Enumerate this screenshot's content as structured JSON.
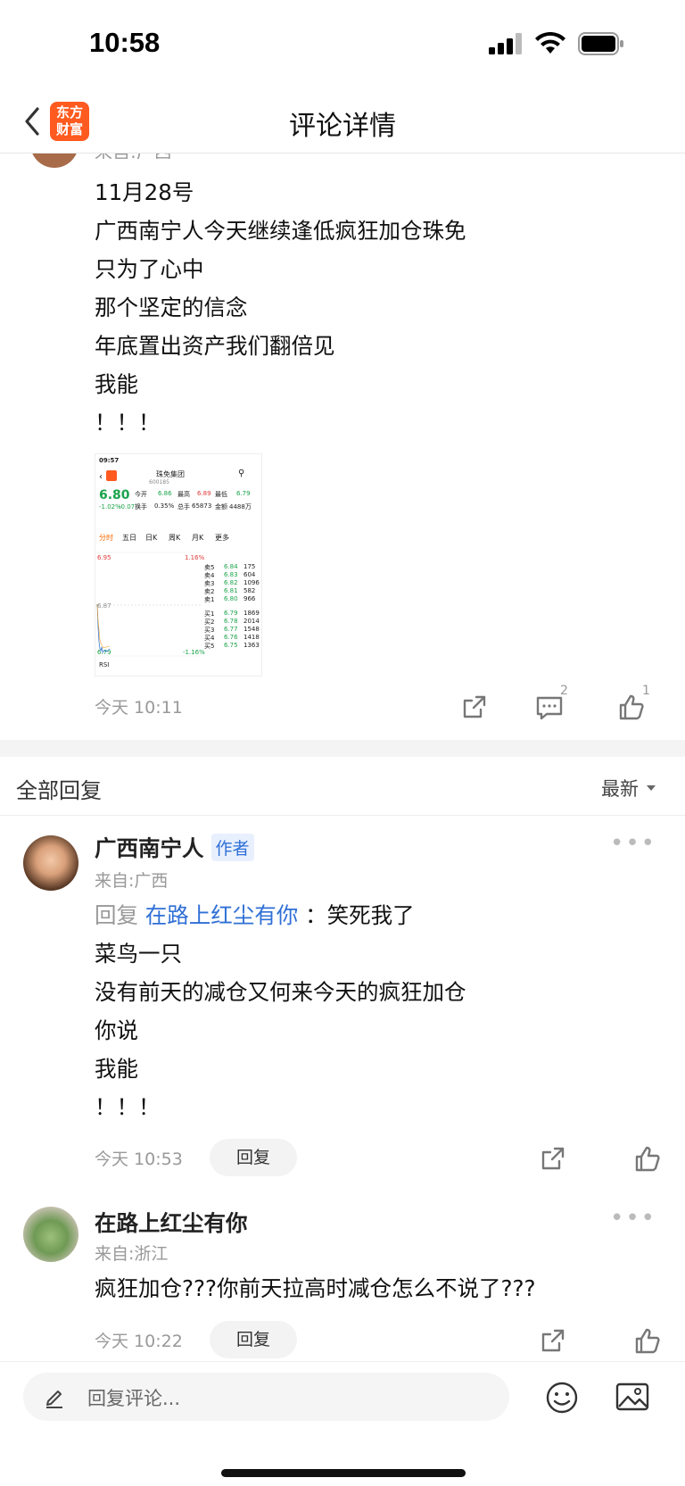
{
  "status": {
    "time": "10:58"
  },
  "nav": {
    "title": "评论详情",
    "logo_line1": "东方",
    "logo_line2": "财富"
  },
  "post": {
    "source_partial": "来自:广西",
    "lines": [
      "11月28号",
      "广西南宁人今天继续逢低疯狂加仓珠免",
      "只为了心中",
      "那个坚定的信念",
      "年底置出资产我们翻倍见",
      "我能",
      "！！！"
    ],
    "thumb": {
      "time": "09:57",
      "stock_name": "珠免集团",
      "stock_code": "600185",
      "price": "6.80",
      "change": "-1.02%",
      "change_abs": "-0.07",
      "open_label": "今开",
      "open": "6.86",
      "high_label": "最高",
      "high": "6.89",
      "low_label": "最低",
      "low": "6.79",
      "turnover_label": "换手",
      "turnover": "0.35%",
      "volume_label": "总手",
      "volume": "65873",
      "amount_label": "金额",
      "amount": "4488万",
      "tabs": [
        "分时",
        "五日",
        "日K",
        "周K",
        "月K",
        "更多"
      ],
      "top_price": "6.95",
      "top_pct": "1.16%",
      "mid_price": "6.87",
      "bottom_price": "6.79",
      "bottom_pct": "-1.16%",
      "asks": [
        [
          "卖5",
          "6.84",
          "175"
        ],
        [
          "卖4",
          "6.83",
          "604"
        ],
        [
          "卖3",
          "6.82",
          "1096"
        ],
        [
          "卖2",
          "6.81",
          "582"
        ],
        [
          "卖1",
          "6.80",
          "966"
        ]
      ],
      "bids": [
        [
          "买1",
          "6.79",
          "1869"
        ],
        [
          "买2",
          "6.78",
          "2014"
        ],
        [
          "买3",
          "6.77",
          "1548"
        ],
        [
          "买4",
          "6.76",
          "1418"
        ],
        [
          "买5",
          "6.75",
          "1363"
        ]
      ],
      "rsi": "RSI"
    },
    "time": "今天 10:11",
    "comment_count": "2",
    "like_count": "1"
  },
  "replies": {
    "title": "全部回复",
    "sort_label": "最新",
    "items": [
      {
        "name": "广西南宁人",
        "badge": "作者",
        "from": "来自:广西",
        "reply_prefix": "回复",
        "reply_target": "在路上红尘有你",
        "reply_first": "：笑死我了",
        "lines": [
          "菜鸟一只",
          "没有前天的减仓又何来今天的疯狂加仓",
          "你说",
          "我能",
          "！！！"
        ],
        "time": "今天 10:53",
        "reply_button": "回复"
      },
      {
        "name": "在路上红尘有你",
        "from": "来自:浙江",
        "lines": [
          "疯狂加仓???你前天拉高时减仓怎么不说了???"
        ],
        "time": "今天 10:22",
        "reply_button": "回复"
      }
    ]
  },
  "bottom": {
    "placeholder": "回复评论..."
  },
  "colors": {
    "brand": "#ff5a1f",
    "link": "#2f6fd6",
    "muted": "#999999"
  }
}
